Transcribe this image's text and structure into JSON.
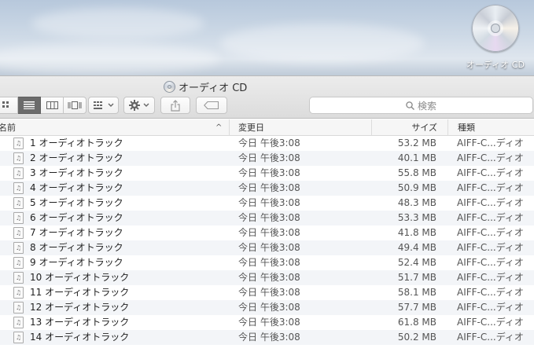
{
  "desktop": {
    "disc_label": "オーディオ CD"
  },
  "window": {
    "title": "オーディオ CD",
    "toolbar": {
      "view_modes": [
        "icon-view",
        "list-view",
        "column-view",
        "coverflow-view"
      ],
      "active_view": "list-view",
      "search_placeholder": "検索"
    },
    "columns": {
      "name": "名前",
      "date": "変更日",
      "size": "サイズ",
      "kind": "種類"
    },
    "rows": [
      {
        "name": "1 オーディオトラック",
        "date": "今日 午後3:08",
        "size": "53.2 MB",
        "kind": "AIFF-C...ディオ"
      },
      {
        "name": "2 オーディオトラック",
        "date": "今日 午後3:08",
        "size": "40.1 MB",
        "kind": "AIFF-C...ディオ"
      },
      {
        "name": "3 オーディオトラック",
        "date": "今日 午後3:08",
        "size": "55.8 MB",
        "kind": "AIFF-C...ディオ"
      },
      {
        "name": "4 オーディオトラック",
        "date": "今日 午後3:08",
        "size": "50.9 MB",
        "kind": "AIFF-C...ディオ"
      },
      {
        "name": "5 オーディオトラック",
        "date": "今日 午後3:08",
        "size": "48.3 MB",
        "kind": "AIFF-C...ディオ"
      },
      {
        "name": "6 オーディオトラック",
        "date": "今日 午後3:08",
        "size": "53.3 MB",
        "kind": "AIFF-C...ディオ"
      },
      {
        "name": "7 オーディオトラック",
        "date": "今日 午後3:08",
        "size": "41.8 MB",
        "kind": "AIFF-C...ディオ"
      },
      {
        "name": "8 オーディオトラック",
        "date": "今日 午後3:08",
        "size": "49.4 MB",
        "kind": "AIFF-C...ディオ"
      },
      {
        "name": "9 オーディオトラック",
        "date": "今日 午後3:08",
        "size": "52.4 MB",
        "kind": "AIFF-C...ディオ"
      },
      {
        "name": "10 オーディオトラック",
        "date": "今日 午後3:08",
        "size": "51.7 MB",
        "kind": "AIFF-C...ディオ"
      },
      {
        "name": "11 オーディオトラック",
        "date": "今日 午後3:08",
        "size": "58.1 MB",
        "kind": "AIFF-C...ディオ"
      },
      {
        "name": "12 オーディオトラック",
        "date": "今日 午後3:08",
        "size": "57.7 MB",
        "kind": "AIFF-C...ディオ"
      },
      {
        "name": "13 オーディオトラック",
        "date": "今日 午後3:08",
        "size": "61.8 MB",
        "kind": "AIFF-C...ディオ"
      },
      {
        "name": "14 オーディオトラック",
        "date": "今日 午後3:08",
        "size": "50.2 MB",
        "kind": "AIFF-C...ディオ"
      }
    ]
  }
}
